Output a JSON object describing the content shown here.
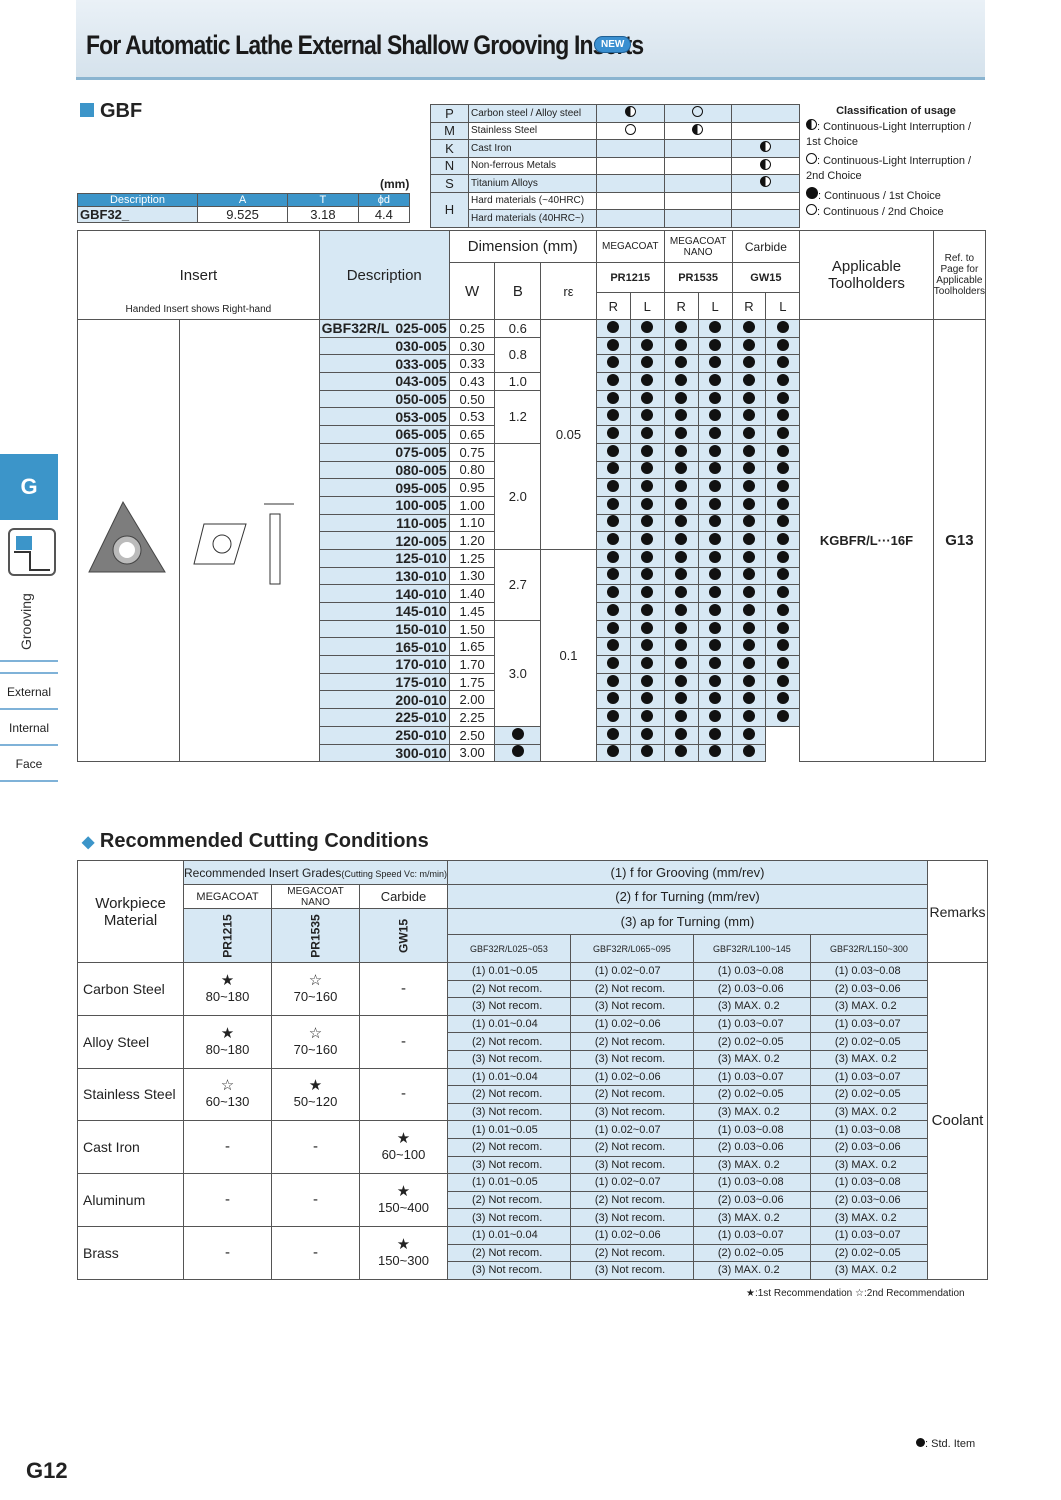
{
  "title": "For Automatic Lathe External Shallow Grooving Inserts",
  "new_badge": "NEW",
  "side": {
    "tab": "G",
    "grooving": "Grooving",
    "items": [
      "External",
      "Internal",
      "Face"
    ]
  },
  "gbf": {
    "heading": "GBF",
    "mm": "(mm)",
    "dim_headers": [
      "Description",
      "A",
      "T",
      "ϕd"
    ],
    "dim_row": [
      "GBF32_",
      "9.525",
      "3.18",
      "4.4"
    ]
  },
  "materials": [
    {
      "code": "P",
      "name": "Carbon steel / Alloy steel",
      "marks": [
        "half",
        "ring",
        ""
      ]
    },
    {
      "code": "M",
      "name": "Stainless Steel",
      "marks": [
        "ring",
        "half",
        ""
      ]
    },
    {
      "code": "K",
      "name": "Cast Iron",
      "marks": [
        "",
        "",
        "half"
      ]
    },
    {
      "code": "N",
      "name": "Non-ferrous Metals",
      "marks": [
        "",
        "",
        "half"
      ]
    },
    {
      "code": "S",
      "name": "Titanium Alloys",
      "marks": [
        "",
        "",
        "half"
      ]
    },
    {
      "code": "H",
      "name": "Hard materials (~40HRC)",
      "marks": [
        "",
        "",
        ""
      ]
    },
    {
      "code": "",
      "name": "Hard materials (40HRC~)",
      "marks": [
        "",
        "",
        ""
      ]
    }
  ],
  "classification": {
    "title": "Classification of usage",
    "items": [
      ": Continuous-Light Interruption / 1st Choice",
      ": Continuous-Light Interruption / 2nd Choice",
      ": Continuous / 1st Choice",
      ": Continuous / 2nd Choice"
    ]
  },
  "main_table": {
    "insert_label": "Insert",
    "handed_note": "Handed Insert shows Right-hand",
    "description_label": "Description",
    "dimension_label": "Dimension (mm)",
    "w": "W",
    "b": "B",
    "re": "rε",
    "grade_groups": [
      "MEGACOAT",
      "MEGACOAT NANO",
      "Carbide"
    ],
    "grades": [
      "PR1215",
      "PR1535",
      "GW15"
    ],
    "r": "R",
    "l": "L",
    "applicable_label": "Applicable Toolholders",
    "ref_label": "Ref. to Page for Applicable Toolholders",
    "prefix": "GBF32R/L",
    "holder": "KGBFR/L···16F",
    "ref_page": "G13",
    "rows": [
      [
        "025-005",
        "0.25"
      ],
      [
        "030-005",
        "0.30"
      ],
      [
        "033-005",
        "0.33"
      ],
      [
        "043-005",
        "0.43"
      ],
      [
        "050-005",
        "0.50"
      ],
      [
        "053-005",
        "0.53"
      ],
      [
        "065-005",
        "0.65"
      ],
      [
        "075-005",
        "0.75"
      ],
      [
        "080-005",
        "0.80"
      ],
      [
        "095-005",
        "0.95"
      ],
      [
        "100-005",
        "1.00"
      ],
      [
        "110-005",
        "1.10"
      ],
      [
        "120-005",
        "1.20"
      ],
      [
        "125-010",
        "1.25"
      ],
      [
        "130-010",
        "1.30"
      ],
      [
        "140-010",
        "1.40"
      ],
      [
        "145-010",
        "1.45"
      ],
      [
        "150-010",
        "1.50"
      ],
      [
        "165-010",
        "1.65"
      ],
      [
        "170-010",
        "1.70"
      ],
      [
        "175-010",
        "1.75"
      ],
      [
        "200-010",
        "2.00"
      ],
      [
        "225-010",
        "2.25"
      ],
      [
        "250-010",
        "2.50"
      ],
      [
        "300-010",
        "3.00"
      ]
    ],
    "b_groups": [
      [
        "0.6",
        1
      ],
      [
        "0.8",
        2
      ],
      [
        "1.0",
        1
      ],
      [
        "1.2",
        3
      ],
      [
        "2.0",
        6
      ],
      [
        "2.7",
        4
      ],
      [
        "3.0",
        6
      ]
    ],
    "re_groups": [
      [
        "0.05",
        13
      ],
      [
        "0.1",
        12
      ]
    ]
  },
  "rec": {
    "heading": "Recommended Cutting Conditions",
    "workpiece": "Workpiece Material",
    "grades_label": "Recommended Insert Grades",
    "speed_note": "(Cutting Speed Vc: m/min)",
    "groups": [
      "MEGACOAT",
      "MEGACOAT NANO",
      "Carbide"
    ],
    "grades": [
      "PR1215",
      "PR1535",
      "GW15"
    ],
    "f_grooving": "(1) f for Grooving (mm/rev)",
    "f_turning": "(2) f for Turning (mm/rev)",
    "ap_turning": "(3) ap for Turning (mm)",
    "ranges": [
      "GBF32R/L025~053",
      "GBF32R/L065~095",
      "GBF32R/L100~145",
      "GBF32R/L150~300"
    ],
    "remarks": "Remarks",
    "coolant": "Coolant",
    "rows": [
      {
        "name": "Carbon Steel",
        "g": [
          [
            "★",
            "80~180"
          ],
          [
            "☆",
            "70~160"
          ],
          [
            "-",
            ""
          ]
        ],
        "c": [
          [
            "(1) 0.01~0.05",
            "(1) 0.02~0.07",
            "(1) 0.03~0.08",
            "(1) 0.03~0.08"
          ],
          [
            "(2) Not recom.",
            "(2) Not recom.",
            "(2) 0.03~0.06",
            "(2) 0.03~0.06"
          ],
          [
            "(3) Not recom.",
            "(3) Not recom.",
            "(3) MAX. 0.2",
            "(3) MAX. 0.2"
          ]
        ]
      },
      {
        "name": "Alloy Steel",
        "g": [
          [
            "★",
            "80~180"
          ],
          [
            "☆",
            "70~160"
          ],
          [
            "-",
            ""
          ]
        ],
        "c": [
          [
            "(1) 0.01~0.04",
            "(1) 0.02~0.06",
            "(1) 0.03~0.07",
            "(1) 0.03~0.07"
          ],
          [
            "(2) Not recom.",
            "(2) Not recom.",
            "(2) 0.02~0.05",
            "(2) 0.02~0.05"
          ],
          [
            "(3) Not recom.",
            "(3) Not recom.",
            "(3) MAX. 0.2",
            "(3) MAX. 0.2"
          ]
        ]
      },
      {
        "name": "Stainless Steel",
        "g": [
          [
            "☆",
            "60~130"
          ],
          [
            "★",
            "50~120"
          ],
          [
            "-",
            ""
          ]
        ],
        "c": [
          [
            "(1) 0.01~0.04",
            "(1) 0.02~0.06",
            "(1) 0.03~0.07",
            "(1) 0.03~0.07"
          ],
          [
            "(2) Not recom.",
            "(2) Not recom.",
            "(2) 0.02~0.05",
            "(2) 0.02~0.05"
          ],
          [
            "(3) Not recom.",
            "(3) Not recom.",
            "(3) MAX. 0.2",
            "(3) MAX. 0.2"
          ]
        ]
      },
      {
        "name": "Cast Iron",
        "g": [
          [
            "-",
            ""
          ],
          [
            "-",
            ""
          ],
          [
            "★",
            "60~100"
          ]
        ],
        "c": [
          [
            "(1) 0.01~0.05",
            "(1) 0.02~0.07",
            "(1) 0.03~0.08",
            "(1) 0.03~0.08"
          ],
          [
            "(2) Not recom.",
            "(2) Not recom.",
            "(2) 0.03~0.06",
            "(2) 0.03~0.06"
          ],
          [
            "(3) Not recom.",
            "(3) Not recom.",
            "(3) MAX. 0.2",
            "(3) MAX. 0.2"
          ]
        ]
      },
      {
        "name": "Aluminum",
        "g": [
          [
            "-",
            ""
          ],
          [
            "-",
            ""
          ],
          [
            "★",
            "150~400"
          ]
        ],
        "c": [
          [
            "(1) 0.01~0.05",
            "(1) 0.02~0.07",
            "(1) 0.03~0.08",
            "(1) 0.03~0.08"
          ],
          [
            "(2) Not recom.",
            "(2) Not recom.",
            "(2) 0.03~0.06",
            "(2) 0.03~0.06"
          ],
          [
            "(3) Not recom.",
            "(3) Not recom.",
            "(3) MAX. 0.2",
            "(3) MAX. 0.2"
          ]
        ]
      },
      {
        "name": "Brass",
        "g": [
          [
            "-",
            ""
          ],
          [
            "-",
            ""
          ],
          [
            "★",
            "150~300"
          ]
        ],
        "c": [
          [
            "(1) 0.01~0.04",
            "(1) 0.02~0.06",
            "(1) 0.03~0.07",
            "(1) 0.03~0.07"
          ],
          [
            "(2) Not recom.",
            "(2) Not recom.",
            "(2) 0.02~0.05",
            "(2) 0.02~0.05"
          ],
          [
            "(3) Not recom.",
            "(3) Not recom.",
            "(3) MAX. 0.2",
            "(3) MAX. 0.2"
          ]
        ]
      }
    ],
    "star_legend": "★:1st Recommendation ☆:2nd Recommendation"
  },
  "std_item": ": Std. Item",
  "page_number": "G12"
}
